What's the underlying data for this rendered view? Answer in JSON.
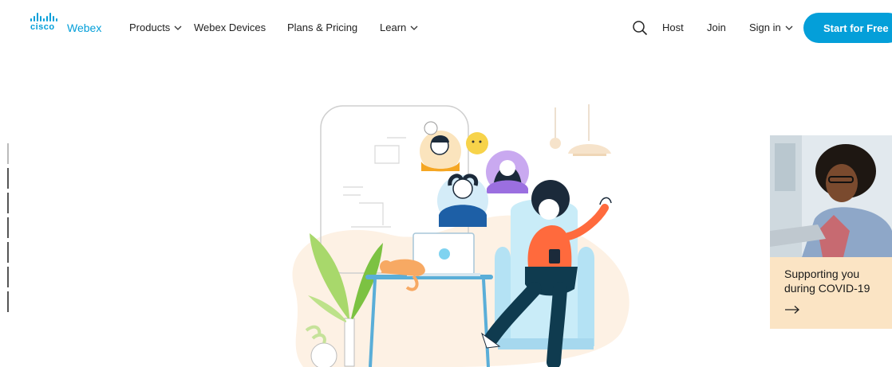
{
  "brand": {
    "logo_cisco": "cisco",
    "logo_webex": "Webex",
    "accent": "#049fd9"
  },
  "nav": {
    "products": "Products",
    "devices": "Webex Devices",
    "pricing": "Plans & Pricing",
    "learn": "Learn"
  },
  "header_actions": {
    "host": "Host",
    "join": "Join",
    "sign_in": "Sign in",
    "cta": "Start for Free"
  },
  "promo": {
    "text": "Supporting you during COVID-19",
    "background": "#fbe4c4"
  }
}
